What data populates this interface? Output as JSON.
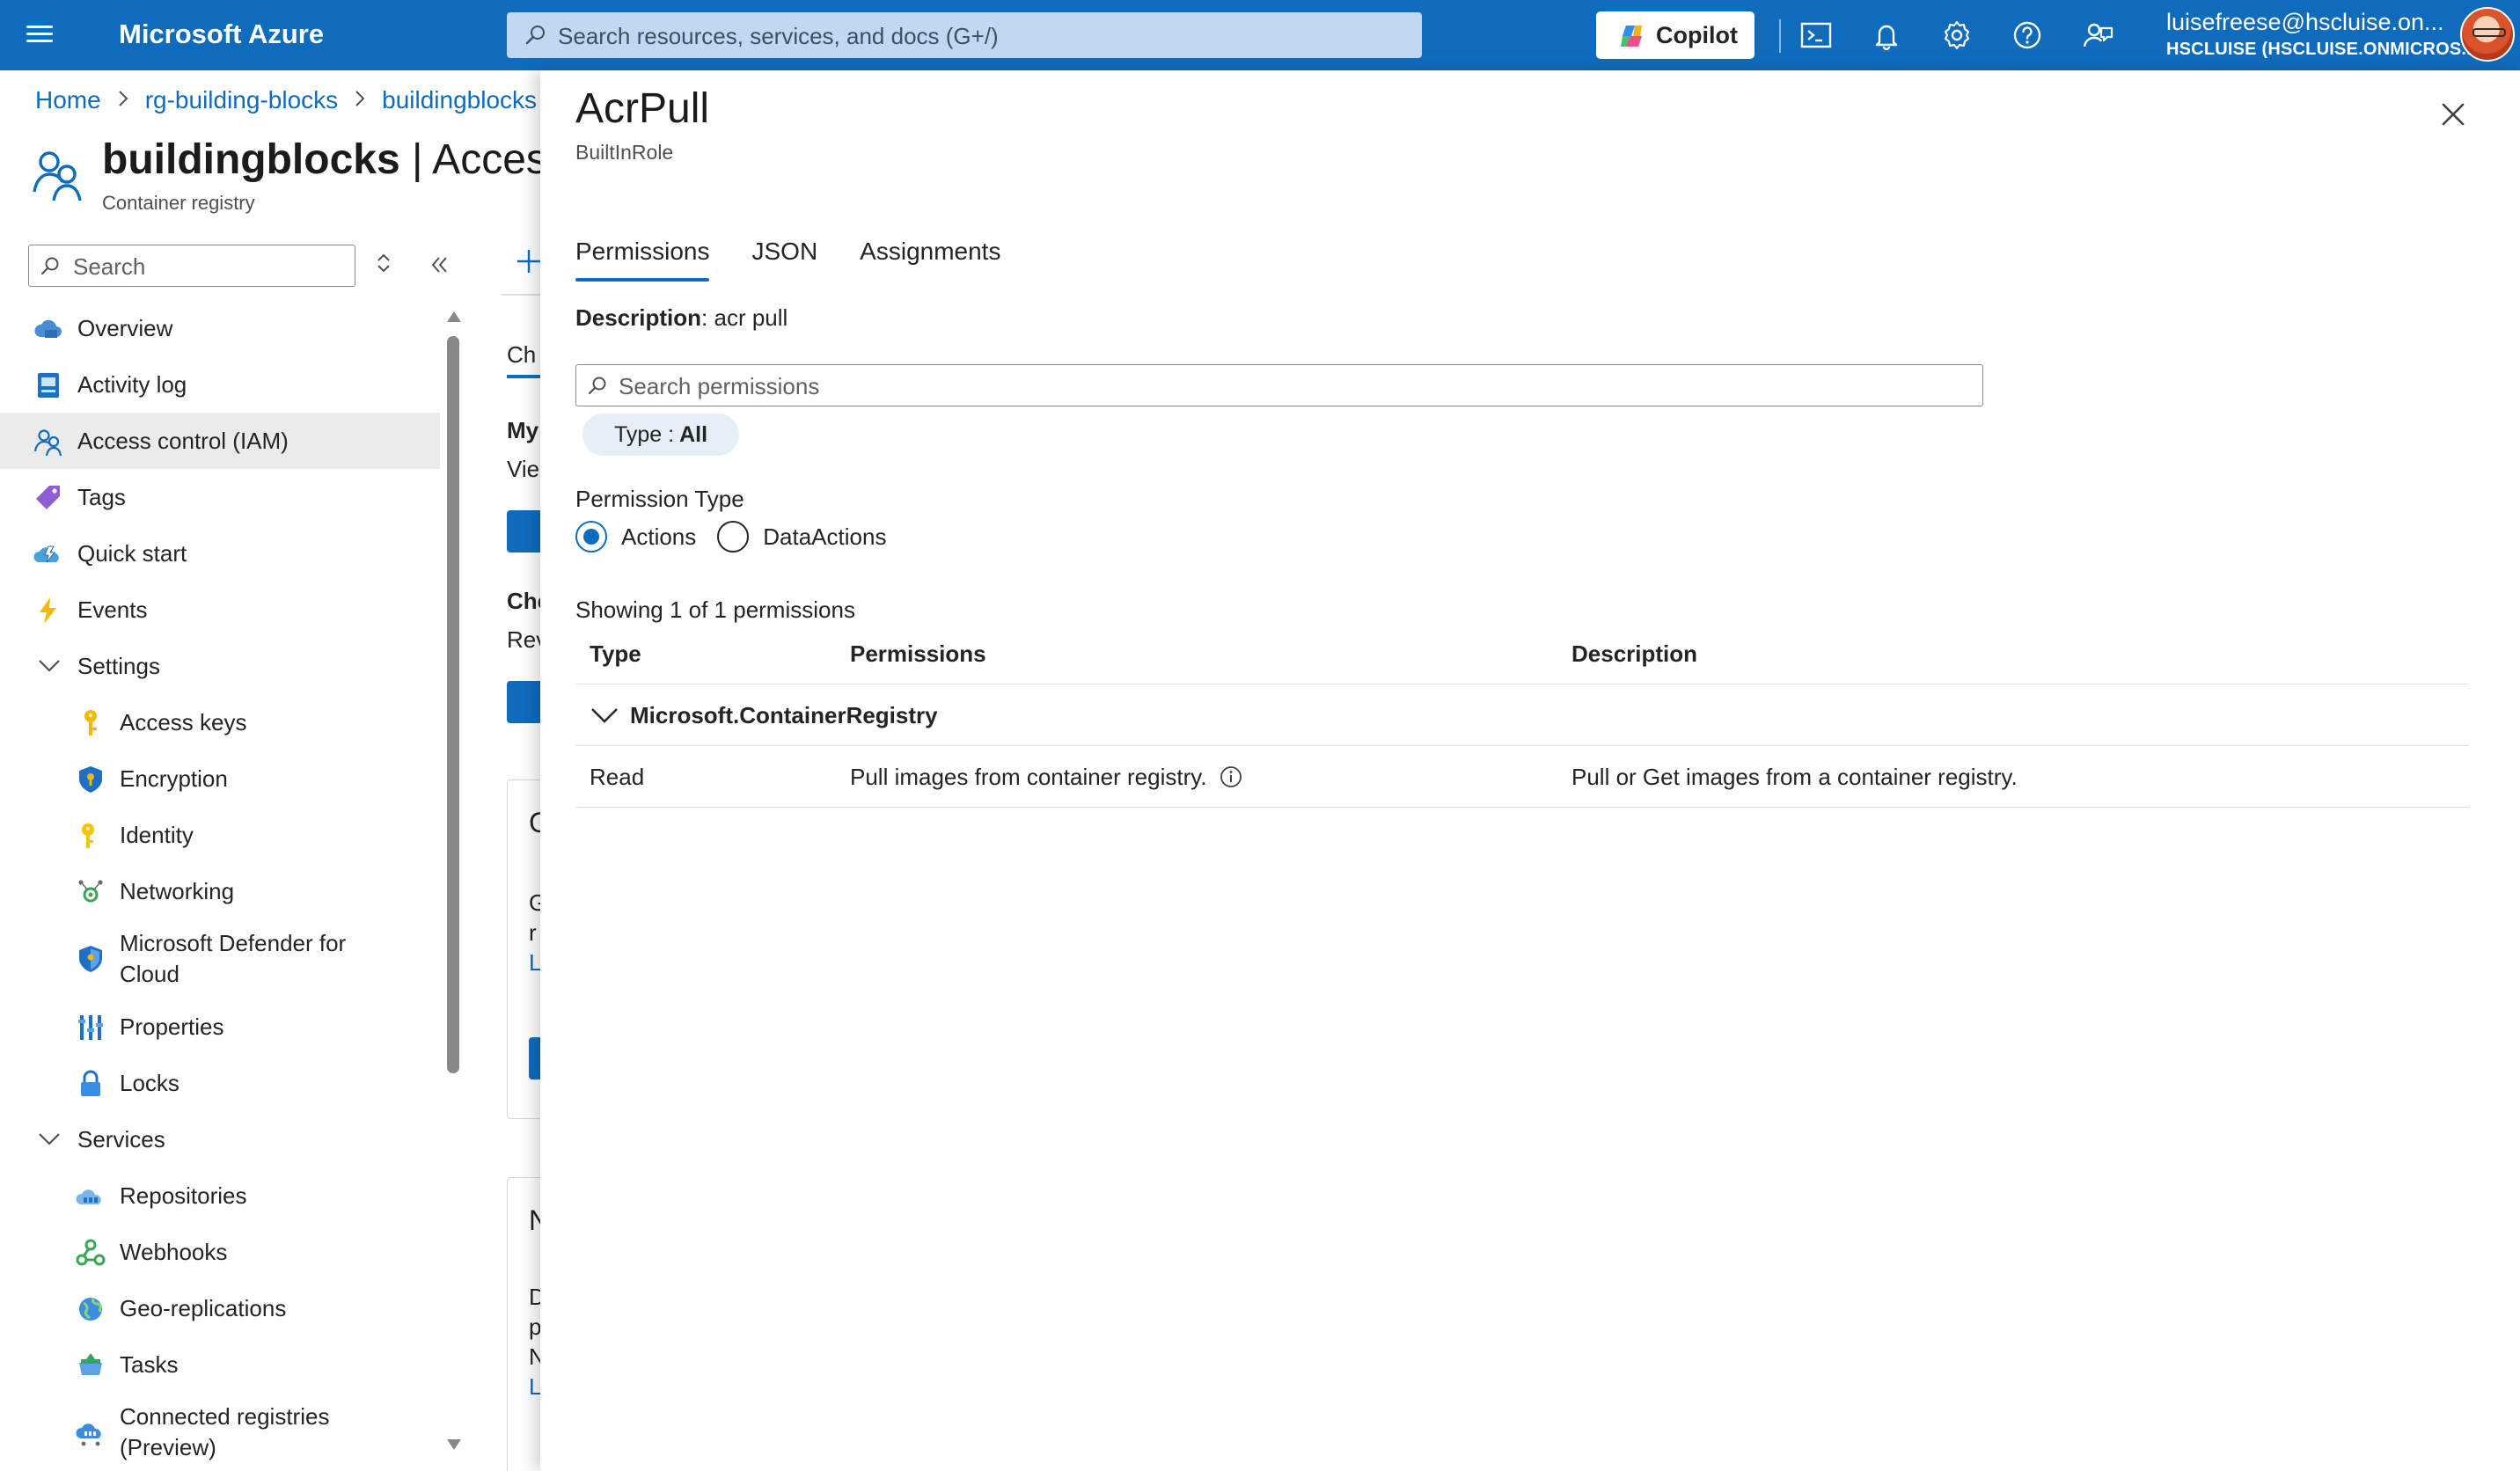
{
  "topbar": {
    "brand": "Microsoft Azure",
    "search_placeholder": "Search resources, services, and docs (G+/)",
    "copilot_label": "Copilot",
    "account_user": "luisefreese@hscluise.on...",
    "account_tenant": "HSCLUISE (HSCLUISE.ONMICROS..."
  },
  "breadcrumb": {
    "items": [
      "Home",
      "rg-building-blocks",
      "buildingblocks"
    ]
  },
  "resource": {
    "name": "buildingblocks",
    "section": "| Access",
    "type": "Container registry"
  },
  "sidebar": {
    "search_placeholder": "Search",
    "items": [
      {
        "label": "Overview",
        "icon": "cloud-icon"
      },
      {
        "label": "Activity log",
        "icon": "log-icon"
      },
      {
        "label": "Access control (IAM)",
        "icon": "users-icon",
        "selected": true
      },
      {
        "label": "Tags",
        "icon": "tag-icon"
      },
      {
        "label": "Quick start",
        "icon": "quickstart-icon"
      },
      {
        "label": "Events",
        "icon": "bolt-icon"
      },
      {
        "label": "Settings",
        "icon": "chevron-down-icon",
        "group": true
      },
      {
        "label": "Access keys",
        "icon": "key-icon"
      },
      {
        "label": "Encryption",
        "icon": "shield-icon"
      },
      {
        "label": "Identity",
        "icon": "identity-key-icon"
      },
      {
        "label": "Networking",
        "icon": "network-icon"
      },
      {
        "label": "Microsoft Defender for Cloud",
        "icon": "defender-icon"
      },
      {
        "label": "Properties",
        "icon": "properties-icon"
      },
      {
        "label": "Locks",
        "icon": "lock-icon"
      },
      {
        "label": "Services",
        "icon": "chevron-down-icon",
        "group": true
      },
      {
        "label": "Repositories",
        "icon": "repositories-icon"
      },
      {
        "label": "Webhooks",
        "icon": "webhook-icon"
      },
      {
        "label": "Geo-replications",
        "icon": "globe-icon"
      },
      {
        "label": "Tasks",
        "icon": "tasks-icon"
      },
      {
        "label": "Connected registries (Preview)",
        "icon": "connected-registry-icon"
      }
    ]
  },
  "peek": {
    "tab": "Ch",
    "my": "My",
    "view": "Vie",
    "che": "Che",
    "rev": "Rev",
    "card1_letter": "G",
    "card1_l1": "G",
    "card1_l2": "r",
    "card1_link": "L",
    "card2_letter": "N",
    "card2_l1": "D",
    "card2_l2": "p",
    "card2_l3": "N",
    "card2_link": "L"
  },
  "panel": {
    "title": "AcrPull",
    "subtitle": "BuiltInRole",
    "tabs": [
      "Permissions",
      "JSON",
      "Assignments"
    ],
    "active_tab": "Permissions",
    "description_key": "Description",
    "description_value": ": acr pull",
    "search_placeholder": "Search permissions",
    "type_filter_key": "Type :",
    "type_filter_value": "All",
    "permission_type_label": "Permission Type",
    "permission_type_options": [
      "Actions",
      "DataActions"
    ],
    "permission_type_selected": "Actions",
    "showing_text": "Showing 1 of 1 permissions",
    "columns": [
      "Type",
      "Permissions",
      "Description"
    ],
    "groups": [
      {
        "name": "Microsoft.ContainerRegistry",
        "rows": [
          {
            "type": "Read",
            "permission": "Pull images from container registry.",
            "description": "Pull or Get images from a container registry."
          }
        ]
      }
    ]
  },
  "colors": {
    "accent": "#0f6cbd",
    "topbar": "#0f6cbd",
    "selected_nav": "#ebebeb"
  }
}
